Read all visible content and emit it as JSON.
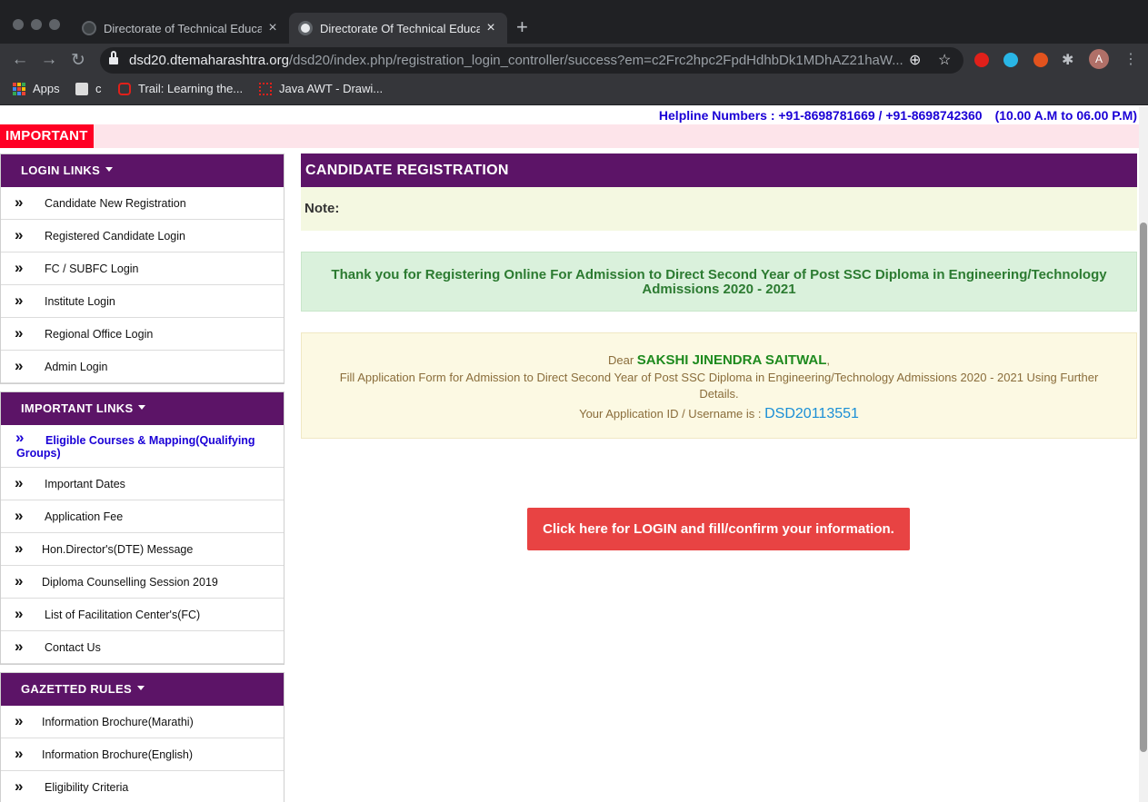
{
  "browser": {
    "tabs": [
      {
        "title": "Directorate of Technical Educat",
        "active": false
      },
      {
        "title": "Directorate Of Technical Educat",
        "active": true
      }
    ],
    "url_host": "dsd20.dtemaharashtra.org",
    "url_path": "/dsd20/index.php/registration_login_controller/success?em=c2Frc2hpc2FpdHdhbDk1MDhAZ21haW...",
    "bookmarks": [
      "Apps",
      "c",
      "Trail: Learning the...",
      "Java AWT - Drawi..."
    ],
    "avatar_initial": "A"
  },
  "page": {
    "helpline": "Helpline Numbers : +91-8698781669 / +91-8698742360",
    "hours": "(10.00 A.M to 06.00 P.M)",
    "important_label": "IMPORTANT",
    "sidebar": {
      "login_links": {
        "title": "LOGIN LINKS",
        "items": [
          "Candidate New Registration",
          "Registered Candidate Login",
          "FC / SUBFC Login",
          "Institute Login",
          "Regional Office Login",
          "Admin Login"
        ]
      },
      "important_links": {
        "title": "IMPORTANT LINKS",
        "items": [
          "Eligible Courses & Mapping(Qualifying Groups)",
          "Important Dates",
          "Application Fee",
          "Hon.Director's(DTE) Message",
          "Diploma Counselling Session 2019",
          "List of Facilitation Center's(FC)",
          "Contact Us"
        ]
      },
      "gazetted_rules": {
        "title": "GAZETTED RULES",
        "items": [
          "Information Brochure(Marathi)",
          "Information Brochure(English)",
          "Eligibility Criteria"
        ]
      }
    },
    "main": {
      "header": "CANDIDATE REGISTRATION",
      "note": "Note:",
      "thanks": "Thank you for Registering Online For Admission to Direct Second Year of Post SSC Diploma in Engineering/Technology Admissions 2020 - 2021",
      "dear_prefix": "Dear",
      "candidate_name": "SAKSHI JINENDRA SAITWAL",
      "name_suffix": ",",
      "fill_text": "Fill Application Form for Admission to Direct Second Year of Post SSC Diploma in Engineering/Technology Admissions 2020 - 2021 Using Further Details.",
      "appid_label": "Your Application ID / Username is :",
      "appid": "DSD20113551",
      "login_button": "Click here for LOGIN and fill/confirm your information."
    }
  },
  "colors": {
    "brand_purple": "#5c1467",
    "important_red": "#ff0024",
    "helpline_blue": "#1a00d6",
    "button_red": "#e84343",
    "success_green": "#2c7b31"
  }
}
